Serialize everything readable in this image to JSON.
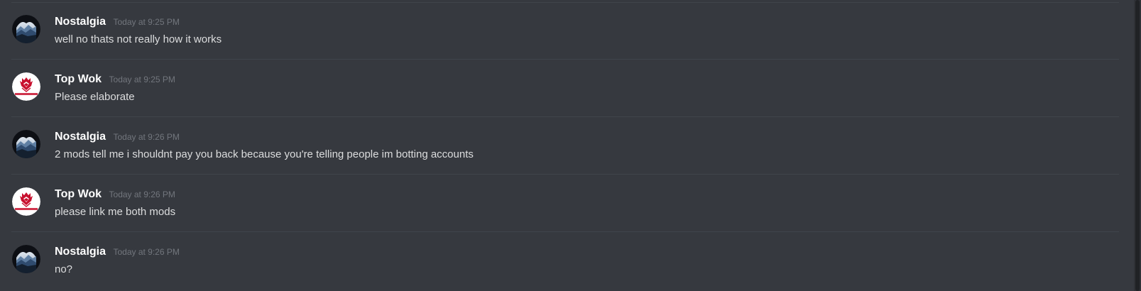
{
  "messages": [
    {
      "author": "Nostalgia",
      "avatar_icon": "mountain-avatar-icon",
      "timestamp": "Today at 9:25 PM",
      "text": "well no thats not really how it works"
    },
    {
      "author": "Top Wok",
      "avatar_icon": "red-crest-avatar-icon",
      "timestamp": "Today at 9:25 PM",
      "text": "Please elaborate"
    },
    {
      "author": "Nostalgia",
      "avatar_icon": "mountain-avatar-icon",
      "timestamp": "Today at 9:26 PM",
      "text": "2 mods tell me i shouldnt pay you back because you're telling people im botting accounts"
    },
    {
      "author": "Top Wok",
      "avatar_icon": "red-crest-avatar-icon",
      "timestamp": "Today at 9:26 PM",
      "text": "please link me both mods"
    },
    {
      "author": "Nostalgia",
      "avatar_icon": "mountain-avatar-icon",
      "timestamp": "Today at 9:26 PM",
      "text": "no?"
    }
  ],
  "colors": {
    "background": "#36393f",
    "username": "#ffffff",
    "timestamp": "#72767d",
    "message_text": "#dcddde",
    "divider": "#40444b",
    "crest_red": "#c8102e"
  }
}
